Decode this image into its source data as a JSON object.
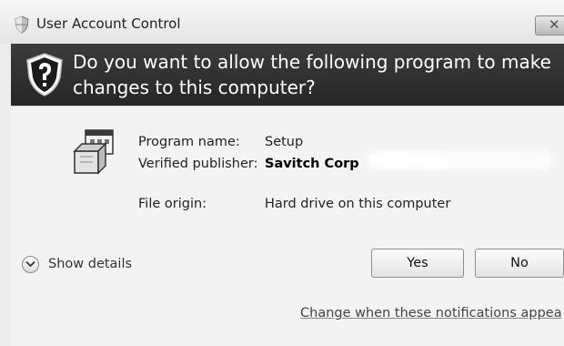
{
  "window": {
    "title": "User Account Control"
  },
  "banner": {
    "question": "Do you want to allow the following program to make changes to this computer?"
  },
  "program": {
    "name_label": "Program name:",
    "name_value": "Setup",
    "publisher_label": "Verified publisher:",
    "publisher_value": "Savitch Corp",
    "origin_label": "File origin:",
    "origin_value": "Hard drive on this computer"
  },
  "actions": {
    "show_details": "Show details",
    "yes": "Yes",
    "no": "No",
    "change_link": "Change when these notifications appea"
  },
  "icons": {
    "title": "uac-shield-small-icon",
    "banner": "uac-shield-icon",
    "program": "installer-box-icon",
    "details": "chevron-down-icon",
    "close": "close-icon"
  },
  "colors": {
    "banner_bg": "#2f2f2f",
    "banner_text": "#ffffff",
    "body_bg": "#f3f3f3"
  }
}
